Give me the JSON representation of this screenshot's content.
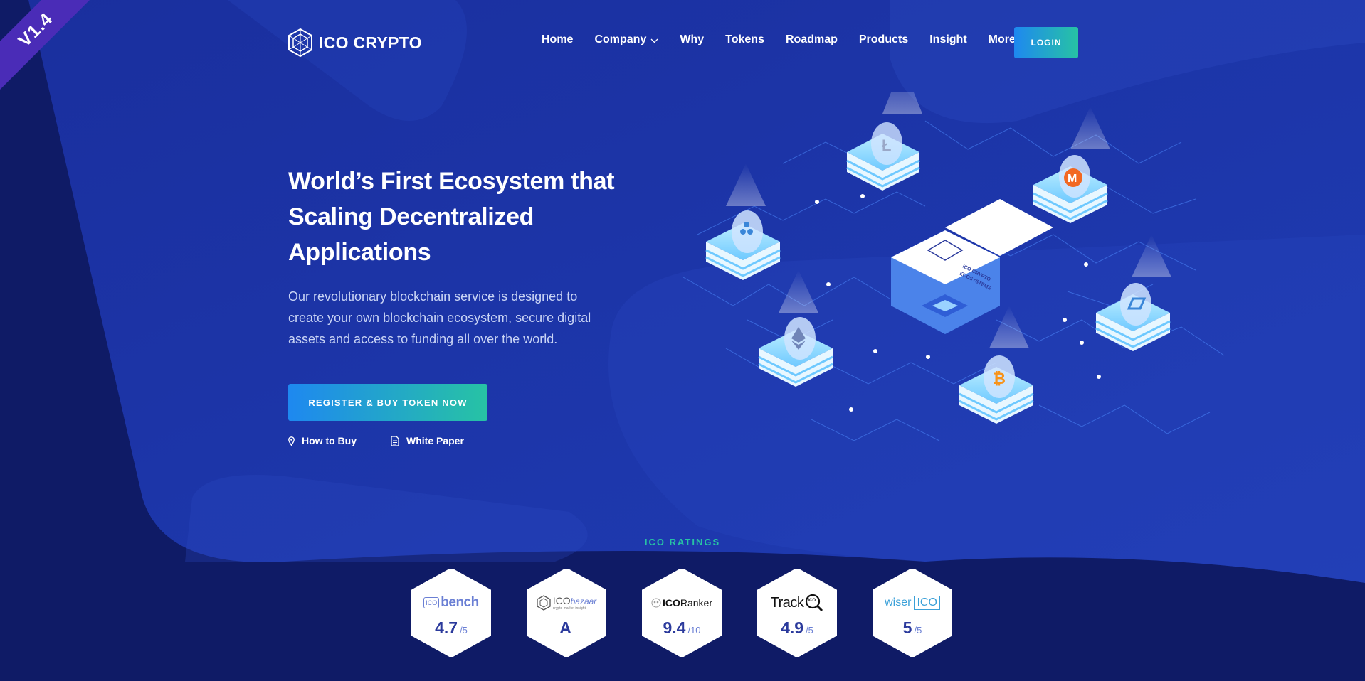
{
  "ribbon": {
    "label": "V1.4"
  },
  "brand": {
    "name": "ICO CRYPTO"
  },
  "nav": {
    "items": [
      {
        "label": "Home"
      },
      {
        "label": "Company"
      },
      {
        "label": "Why"
      },
      {
        "label": "Tokens"
      },
      {
        "label": "Roadmap"
      },
      {
        "label": "Products"
      },
      {
        "label": "Insight"
      },
      {
        "label": "More"
      }
    ],
    "login_label": "LOGIN"
  },
  "hero": {
    "title_line1": "World’s First Ecosystem that",
    "title_line2": "Scaling Decentralized Applications",
    "description": "Our revolutionary blockchain service is designed to create your own blockchain ecosystem, secure digital assets and access to funding all over the world.",
    "cta_label": "REGISTER & BUY TOKEN NOW",
    "link_how": "How to Buy",
    "link_paper": "White Paper"
  },
  "illustration": {
    "center_label_1": "ICO CRYPTO",
    "center_label_2": "ECOSYSTEMS"
  },
  "ratings": {
    "label": "ICO RATINGS",
    "items": [
      {
        "logo_a": "ICO",
        "logo_b": "bench",
        "score": "4.7",
        "scale": "/5"
      },
      {
        "logo_a": "ICO",
        "logo_b": "bazaar",
        "logo_sub": "crypto market insight",
        "score": "A",
        "scale": ""
      },
      {
        "logo_a": "ICO",
        "logo_b": "Ranker",
        "score": "9.4",
        "scale": "/10"
      },
      {
        "logo_a": "Track",
        "logo_b": "ICO",
        "score": "4.9",
        "scale": "/5"
      },
      {
        "logo_a": "wiser",
        "logo_b": "ICO",
        "score": "5",
        "scale": "/5"
      }
    ]
  },
  "colors": {
    "accent_start": "#1e88f0",
    "accent_end": "#27c3a4",
    "bg": "#13237e"
  }
}
